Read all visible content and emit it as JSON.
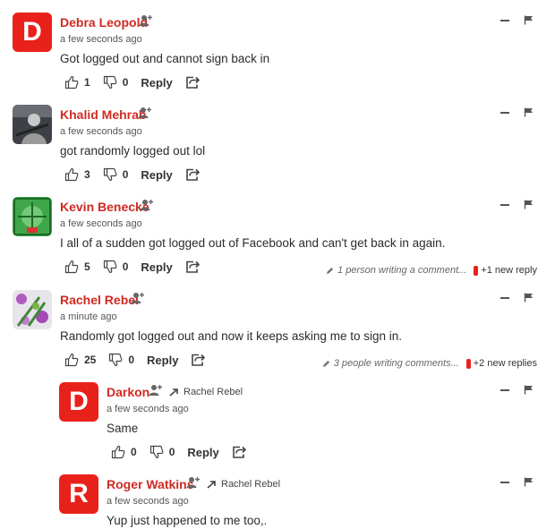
{
  "comments": [
    {
      "author": "Debra Leopold",
      "avatar_letter": "D",
      "time": "a few seconds ago",
      "text": "Got logged out and cannot sign back in",
      "likes": "1",
      "dislikes": "0",
      "reply_label": "Reply"
    },
    {
      "author": "Khalid Mehrab",
      "time": "a few seconds ago",
      "text": "got randomly logged out lol",
      "likes": "3",
      "dislikes": "0",
      "reply_label": "Reply"
    },
    {
      "author": "Kevin Benecke",
      "time": "a few seconds ago",
      "text": "I all of a sudden got logged out of Facebook and can't get back in again.",
      "likes": "5",
      "dislikes": "0",
      "reply_label": "Reply",
      "typing": "1 person writing a comment...",
      "new_replies": "+1 new reply"
    },
    {
      "author": "Rachel Rebel",
      "time": "a minute ago",
      "text": "Randomly got logged out and now it keeps asking me to sign in.",
      "likes": "25",
      "dislikes": "0",
      "reply_label": "Reply",
      "typing": "3 people writing comments...",
      "new_replies": "+2 new replies"
    },
    {
      "author": "Darkon",
      "avatar_letter": "D",
      "reply_to": "Rachel Rebel",
      "time": "a few seconds ago",
      "text": "Same",
      "likes": "0",
      "dislikes": "0",
      "reply_label": "Reply"
    },
    {
      "author": "Roger Watkins",
      "avatar_letter": "R",
      "reply_to": "Rachel Rebel",
      "time": "a few seconds ago",
      "text": "Yup just happened to me too,."
    }
  ],
  "colors": {
    "author": "#d02a22",
    "avatar_bg": "#e8221b",
    "new_reply_marker": "#e8221b"
  },
  "icons": [
    "follow-user-icon",
    "thumbs-up-icon",
    "thumbs-down-icon",
    "share-icon",
    "minimize-icon",
    "flag-icon",
    "pencil-icon",
    "reply-arrow-icon"
  ]
}
